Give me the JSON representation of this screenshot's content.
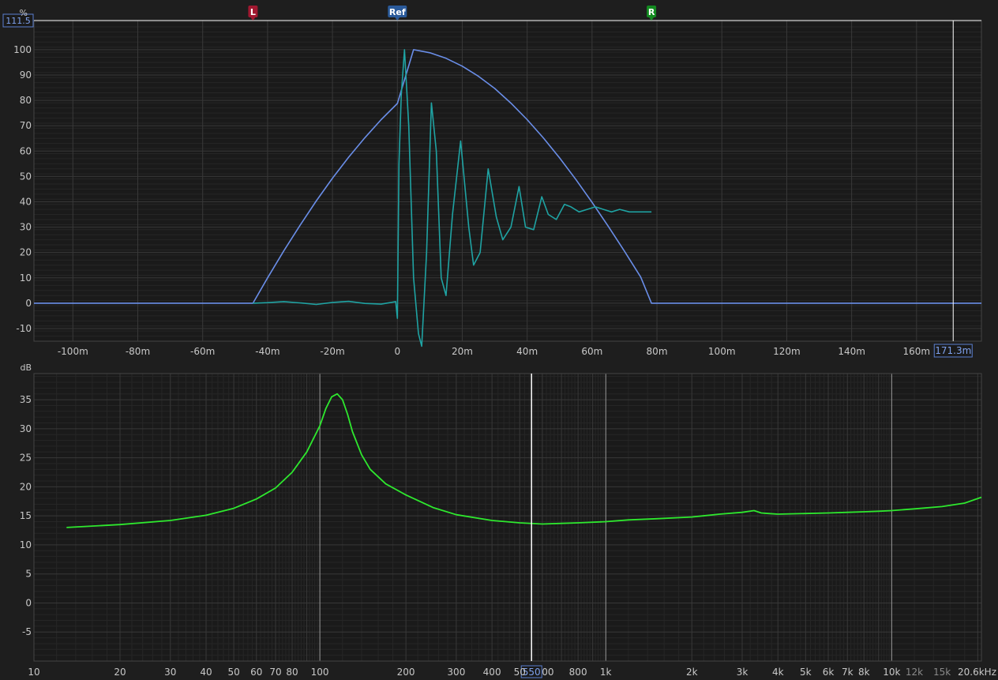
{
  "chart_data": [
    {
      "type": "line",
      "ylabel": "%",
      "xlim": [
        -0.112,
        0.18
      ],
      "ylim": [
        -15,
        111.5
      ],
      "x_ticks": [
        -0.1,
        -0.08,
        -0.06,
        -0.04,
        -0.02,
        0,
        0.02,
        0.04,
        0.06,
        0.08,
        0.1,
        0.12,
        0.14,
        0.16
      ],
      "x_tick_labels": [
        "-100m",
        "-80m",
        "-60m",
        "-40m",
        "-20m",
        "0",
        "20m",
        "40m",
        "60m",
        "80m",
        "100m",
        "120m",
        "140m",
        "160m"
      ],
      "y_ticks": [
        -10,
        0,
        10,
        20,
        30,
        40,
        50,
        60,
        70,
        80,
        90,
        100
      ],
      "y_tick_labels": [
        "-10",
        "0",
        "10",
        "20",
        "30",
        "40",
        "50",
        "60",
        "70",
        "80",
        "90",
        "100"
      ],
      "grid": true,
      "markers": [
        {
          "label": "L",
          "x": -0.0445,
          "color": "#a01830"
        },
        {
          "label": "Ref",
          "x": 0.0,
          "color": "#2a5a9a"
        },
        {
          "label": "R",
          "x": 0.0783,
          "color": "#138a20"
        }
      ],
      "cursor": {
        "x": 0.1713,
        "y": 111.5,
        "x_label": "171.3m",
        "y_label": "111.5"
      },
      "series": [
        {
          "color": "#6a8ee8",
          "x": [
            -0.112,
            -0.0445,
            -0.04,
            -0.035,
            -0.03,
            -0.025,
            -0.02,
            -0.015,
            -0.01,
            -0.005,
            0,
            0.005,
            0.01,
            0.015,
            0.02,
            0.025,
            0.03,
            0.035,
            0.04,
            0.045,
            0.05,
            0.055,
            0.06,
            0.065,
            0.07,
            0.075,
            0.0783,
            0.18
          ],
          "y": [
            0,
            0,
            10.0,
            20.6,
            30.7,
            40.3,
            49.3,
            57.6,
            65.3,
            72.4,
            78.8,
            100,
            98.8,
            96.6,
            93.5,
            89.5,
            84.7,
            78.9,
            72.4,
            65.2,
            57.3,
            48.8,
            39.8,
            30.3,
            20.5,
            10.3,
            0,
            0
          ]
        },
        {
          "color": "#1fa3a3",
          "x": [
            -0.112,
            -0.0445,
            -0.04,
            -0.035,
            -0.03,
            -0.025,
            -0.02,
            -0.015,
            -0.01,
            -0.005,
            -0.0005,
            0,
            0.0005,
            0.0012,
            0.0022,
            0.0035,
            0.005,
            0.0065,
            0.0075,
            0.009,
            0.0105,
            0.012,
            0.0135,
            0.015,
            0.017,
            0.0195,
            0.022,
            0.0235,
            0.0255,
            0.028,
            0.0305,
            0.0325,
            0.035,
            0.0375,
            0.0395,
            0.042,
            0.0445,
            0.0465,
            0.049,
            0.0515,
            0.0535,
            0.056,
            0.0585,
            0.061,
            0.0635,
            0.066,
            0.0685,
            0.0715,
            0.0745,
            0.0783
          ],
          "y": [
            null,
            0,
            0.2,
            0.6,
            0.1,
            -0.5,
            0.3,
            0.7,
            -0.1,
            -0.4,
            0.6,
            -6,
            55,
            82,
            100,
            70,
            10,
            -12,
            -17,
            20,
            79,
            60,
            10,
            3,
            35,
            64,
            30,
            15,
            20,
            53,
            34,
            25,
            30,
            46,
            30,
            29,
            42,
            35,
            33,
            39,
            38,
            36,
            37,
            38,
            37,
            36,
            37,
            36,
            36,
            36
          ]
        }
      ]
    },
    {
      "type": "line",
      "ylabel": "dB",
      "xscale": "log",
      "xlim": [
        10,
        20600
      ],
      "ylim": [
        -10,
        39.5
      ],
      "x_ticks": [
        10,
        20,
        30,
        40,
        50,
        60,
        70,
        80,
        100,
        200,
        300,
        400,
        500,
        800,
        1000,
        2000,
        3000,
        4000,
        5000,
        6000,
        7000,
        8000,
        10000,
        12000,
        15000,
        20600
      ],
      "x_tick_labels": [
        "10",
        "20",
        "30",
        "40",
        "50",
        "60",
        "70",
        "80",
        "100",
        "200",
        "300",
        "400",
        "50",
        "800",
        "1k",
        "2k",
        "3k",
        "4k",
        "5k",
        "6k",
        "7k",
        "8k",
        "10k",
        "12k",
        "15k",
        "20.6kHz"
      ],
      "y_ticks": [
        -5,
        0,
        5,
        10,
        15,
        20,
        25,
        30,
        35
      ],
      "y_tick_labels": [
        "-5",
        "0",
        "5",
        "10",
        "15",
        "20",
        "25",
        "30",
        "35"
      ],
      "grid": true,
      "cursor": {
        "x": 550,
        "x_label": "550",
        "x_label_tail": "00"
      },
      "series": [
        {
          "color": "#2ee82e",
          "x": [
            13,
            20,
            30,
            40,
            50,
            60,
            70,
            80,
            90,
            100,
            105,
            110,
            115,
            120,
            125,
            130,
            140,
            150,
            170,
            200,
            250,
            300,
            400,
            500,
            600,
            700,
            800,
            1000,
            1200,
            1500,
            2000,
            2500,
            3000,
            3300,
            3500,
            3700,
            4000,
            5000,
            6000,
            7000,
            8000,
            9000,
            10000,
            12000,
            15000,
            18000,
            20600
          ],
          "y": [
            13.0,
            13.5,
            14.2,
            15.1,
            16.3,
            17.9,
            19.8,
            22.5,
            26.0,
            30.5,
            33.5,
            35.5,
            36.0,
            35.0,
            32.5,
            29.5,
            25.5,
            23.0,
            20.5,
            18.6,
            16.4,
            15.2,
            14.2,
            13.8,
            13.6,
            13.7,
            13.8,
            14.0,
            14.3,
            14.5,
            14.8,
            15.3,
            15.6,
            15.9,
            15.5,
            15.4,
            15.3,
            15.4,
            15.5,
            15.6,
            15.7,
            15.8,
            15.9,
            16.2,
            16.6,
            17.2,
            18.2
          ]
        }
      ]
    }
  ]
}
